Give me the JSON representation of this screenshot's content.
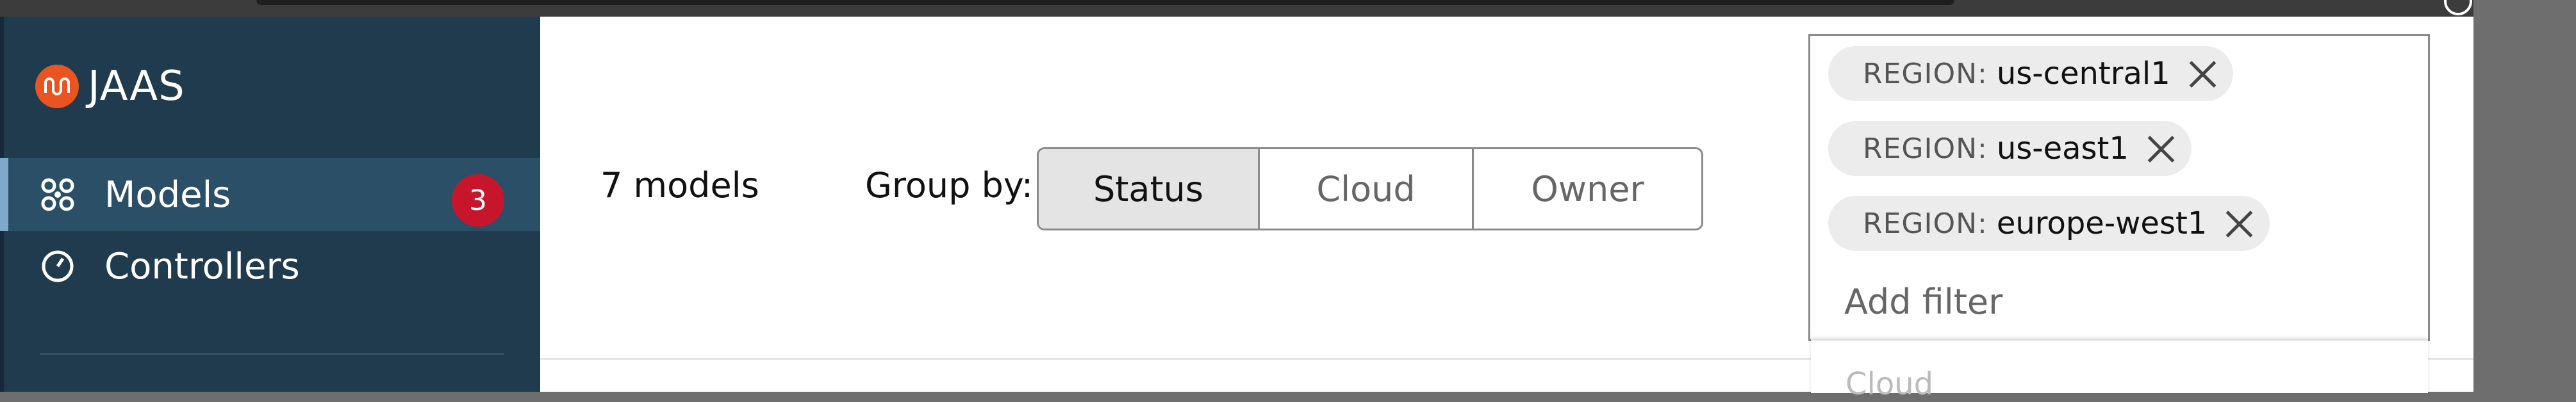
{
  "app": {
    "logo_text": "JAAS"
  },
  "sidebar": {
    "items": [
      {
        "label": "Models",
        "badge": "3",
        "icon": "models-icon",
        "active": true
      },
      {
        "label": "Controllers",
        "icon": "controllers-icon",
        "active": false
      }
    ]
  },
  "main": {
    "model_count": "7 models",
    "group_by_label": "Group by:",
    "group_by_options": [
      "Status",
      "Cloud",
      "Owner"
    ],
    "group_by_selected": "Status"
  },
  "filters": {
    "chips": [
      {
        "key": "REGION:",
        "value": "us-central1"
      },
      {
        "key": "REGION:",
        "value": "us-east1"
      },
      {
        "key": "REGION:",
        "value": "europe-west1"
      }
    ],
    "placeholder": "Add filter",
    "dropdown_partial_text": "Cloud"
  },
  "colors": {
    "sidebar": "#1f3b4d",
    "active_item": "#2a4f66",
    "badge": "#c7162b",
    "logo": "#e95420"
  }
}
